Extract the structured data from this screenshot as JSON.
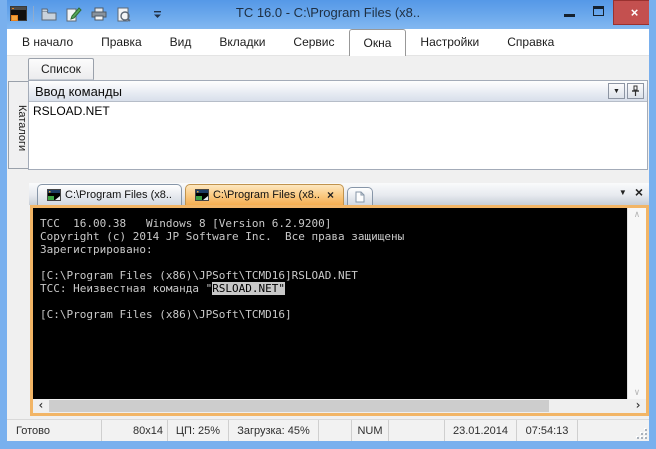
{
  "window": {
    "title": "TC 16.0 - C:\\Program Files (x8..",
    "control_icons": [
      "minimize-icon",
      "maximize-icon",
      "close-icon"
    ]
  },
  "glyphs": {
    "close": "×",
    "dropdown": "▼",
    "scroll_up": "∧",
    "scroll_down": "∨",
    "scroll_left": "‹",
    "scroll_right": "›"
  },
  "toolbar": {
    "icons": [
      "app-icon",
      "open-folder-icon",
      "edit-pen-icon",
      "print-icon",
      "print-preview-icon",
      "toolbar-options-icon"
    ]
  },
  "menu": {
    "items": [
      "В начало",
      "Правка",
      "Вид",
      "Вкладки",
      "Сервис",
      "Окна",
      "Настройки",
      "Справка"
    ],
    "selected": "Окна"
  },
  "panels": {
    "list_tab": "Список",
    "folders_tab": "Каталоги",
    "command_header": "Ввод команды",
    "command_input": "RSLOAD.NET"
  },
  "tabs": {
    "items": [
      {
        "label": "C:\\Program Files (x8..",
        "active": false
      },
      {
        "label": "C:\\Program Files (x8..",
        "active": true
      }
    ]
  },
  "console": {
    "lines": [
      "TCC  16.00.38   Windows 8 [Version 6.2.9200]",
      "Copyright (c) 2014 JP Software Inc.  Все права защищены",
      "Зарегистрировано:",
      "",
      "[C:\\Program Files (x86)\\JPSoft\\TCMD16]RSLOAD.NET"
    ],
    "error_line": {
      "prefix": "TCC: Неизвестная команда \"",
      "highlighted": "RSLOAD.NET\""
    },
    "prompt_line": "[C:\\Program Files (x86)\\JPSoft\\TCMD16]"
  },
  "status_bar": {
    "ready": "Готово",
    "size": "80x14",
    "cpu": "ЦП: 25%",
    "load": "Загрузка: 45%",
    "num": "NUM",
    "date": "23.01.2014",
    "time": "07:54:13"
  },
  "colors": {
    "titlebar_blue": "#5e9de7",
    "close_red": "#c4504f",
    "active_tab_orange": "#f5ae52",
    "console_border_orange": "#f2b566",
    "console_bg": "#000000",
    "console_text": "#c9c9c9",
    "highlight_bg": "#c8c8c8"
  }
}
